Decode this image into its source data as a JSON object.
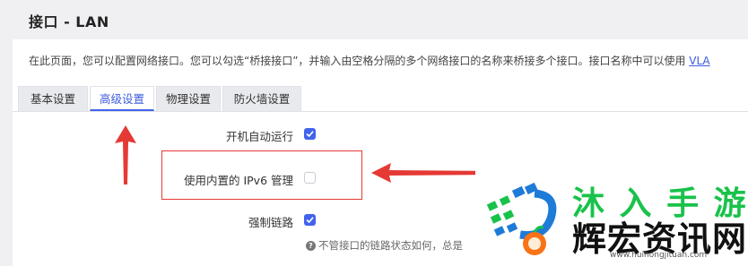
{
  "page": {
    "title": "接口 - LAN",
    "description": "在此页面，您可以配置网络接口。您可以勾选“桥接接口”，并输入由空格分隔的多个网络接口的名称来桥接多个接口。接口名称中可以使用 ",
    "description_link": "VLA"
  },
  "tabs": [
    {
      "label": "基本设置",
      "active": false
    },
    {
      "label": "高级设置",
      "active": true
    },
    {
      "label": "物理设置",
      "active": false
    },
    {
      "label": "防火墙设置",
      "active": false
    }
  ],
  "settings": [
    {
      "label": "开机自动运行",
      "checked": true
    },
    {
      "label": "使用内置的 IPv6 管理",
      "checked": false
    },
    {
      "label": "强制链路",
      "checked": true
    }
  ],
  "help_text": "不管接口的链路状态如何，总是",
  "watermark": {
    "row1": "沐 入 手 游",
    "row2": "辉宏资讯网",
    "url": "www.huihongjituan.com"
  },
  "colors": {
    "accent": "#4263eb",
    "annotation_red": "#e53935",
    "watermark_green": "#19c24a"
  }
}
